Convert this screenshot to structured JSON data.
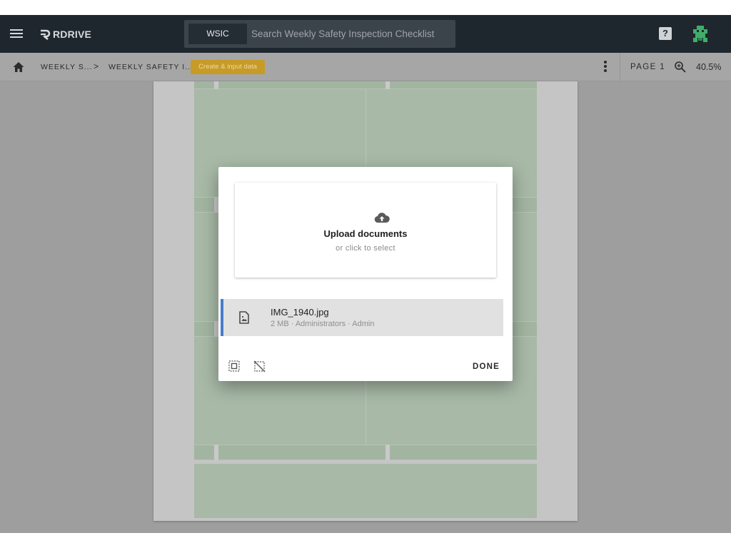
{
  "topbar": {
    "logo_text": "RDRIVE",
    "search_chip": "WSIC",
    "search_placeholder": "Search Weekly Safety Inspection Checklist",
    "help_label": "?"
  },
  "breadcrumb": {
    "items": [
      "WEEKLY S...",
      "WEEKLY SAFETY I..."
    ],
    "separator": ">",
    "badge": "Create & input data"
  },
  "toolbar": {
    "page_label": "PAGE 1",
    "zoom": "40.5%"
  },
  "upload_dialog": {
    "title": "Upload documents",
    "subtitle": "or click to select",
    "files": [
      {
        "name": "IMG_1940.jpg",
        "meta": "2 MB · Administrators · Admin"
      }
    ],
    "done_label": "DONE"
  },
  "icons": {
    "menu": "hamburger-icon",
    "home": "home-icon",
    "more": "more-vert-icon",
    "zoom": "zoom-icon",
    "upload": "cloud-upload-icon",
    "file": "image-file-icon",
    "select_all": "select-all-icon",
    "deselect": "deselect-icon"
  },
  "colors": {
    "topbar": "#1f272e",
    "badge": "#c79b26",
    "accent": "#4a7bcc"
  }
}
